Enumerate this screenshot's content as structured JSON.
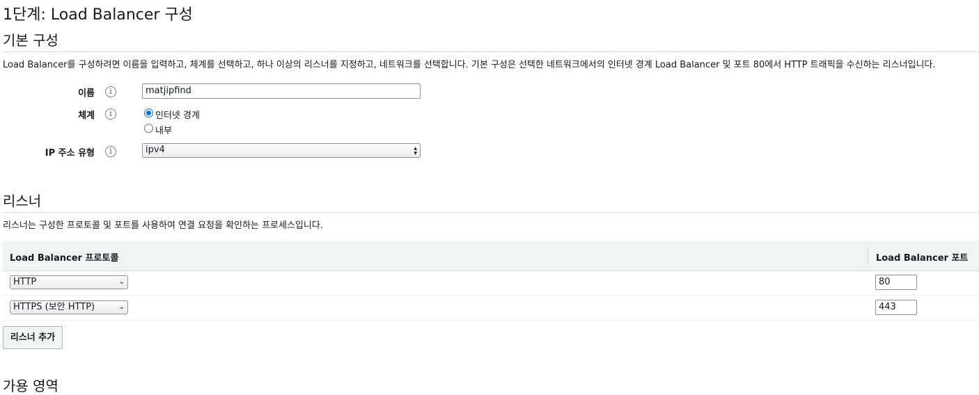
{
  "page_title": "1단계: Load Balancer 구성",
  "basic": {
    "heading": "기본 구성",
    "description": "Load Balancer를 구성하려면 이름을 입력하고, 체계를 선택하고, 하나 이상의 리스너를 지정하고, 네트워크를 선택합니다. 기본 구성은 선택한 네트워크에서의 인터넷 경계 Load Balancer 및 포트 80에서 HTTP 트래픽을 수신하는 리스너입니다.",
    "name_label": "이름",
    "name_value": "matjipfind",
    "scheme_label": "체계",
    "scheme_options": [
      "인터넷 경계",
      "내부"
    ],
    "scheme_selected": "인터넷 경계",
    "ip_label": "IP 주소 유형",
    "ip_value": "ipv4",
    "info_glyph": "i"
  },
  "listeners": {
    "heading": "리스너",
    "description": "리스너는 구성한 프로토콜 및 포트를 사용하여 연결 요청을 확인하는 프로세스입니다.",
    "col_protocol": "Load Balancer 프로토콜",
    "col_port": "Load Balancer 포트",
    "rows": [
      {
        "protocol": "HTTP",
        "port": "80"
      },
      {
        "protocol": "HTTPS (보안 HTTP)",
        "port": "443"
      }
    ],
    "add_button": "리스너 추가"
  },
  "next_heading": "가용 영역",
  "colors": {
    "accent": "#0073e6",
    "header_bg": "#f2f3f3",
    "rule": "#d5dbdb"
  }
}
